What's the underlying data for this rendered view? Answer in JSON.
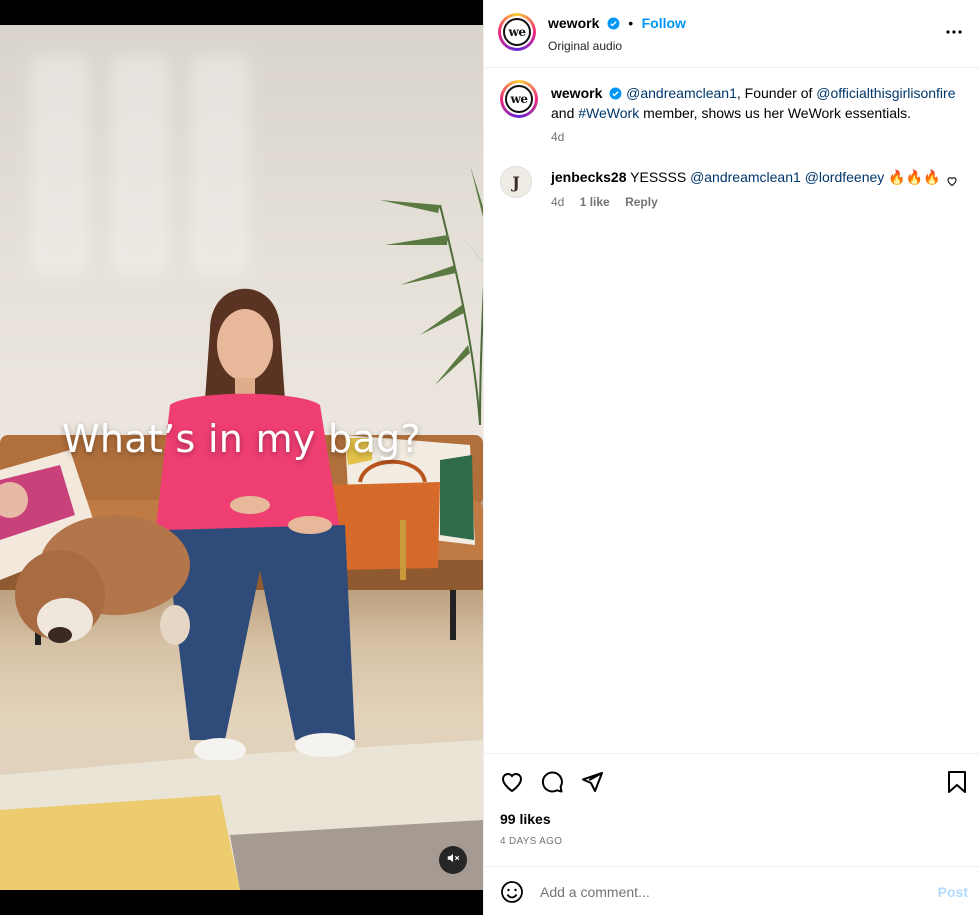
{
  "post": {
    "username": "wework",
    "separator": "•",
    "follow_label": "Follow",
    "audio": "Original audio"
  },
  "video": {
    "overlay_text": "What’s in my bag?"
  },
  "caption": {
    "username": "wework",
    "mention1": "@andreamclean1",
    "text1": ", Founder of ",
    "mention2": "@officialthisgirlisonfire",
    "text2": "and ",
    "hashtag": "#WeWork",
    "text3": " member, shows us her WeWork essentials.",
    "time": "4d"
  },
  "comment": {
    "username": "jenbecks28",
    "text": " YESSSS ",
    "mention1": "@andreamclean1",
    "mention2": "@lordfeeney",
    "emoji": "🔥🔥🔥",
    "time": "4d",
    "likes": "1 like",
    "reply": "Reply"
  },
  "stats": {
    "likes": "99 likes",
    "date": "4 DAYS AGO"
  },
  "composer": {
    "placeholder": "Add a comment...",
    "post_label": "Post"
  },
  "icons": {
    "like": "heart-icon",
    "comment": "comment-icon",
    "share": "send-icon",
    "save": "bookmark-icon",
    "more": "more-icon",
    "mute": "muted-speaker-icon",
    "emoji": "smiley-icon"
  }
}
